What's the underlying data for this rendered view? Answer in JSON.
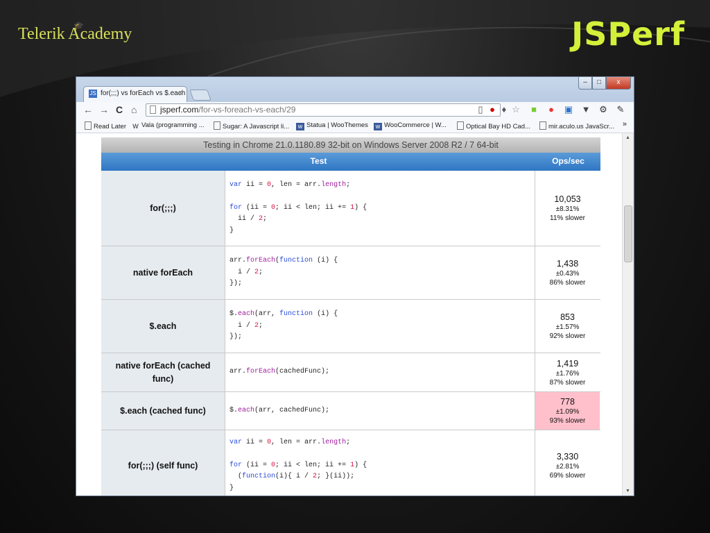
{
  "slide": {
    "logo_text": "Telerik Academy",
    "title": "JSPerf"
  },
  "browser": {
    "tab_title": "for(;;;) vs forEach vs $.each",
    "tab_close": "×",
    "window_buttons": {
      "minimize": "–",
      "maximize": "□",
      "close": "x"
    },
    "url_host": "jsperf.com",
    "url_path": "/for-vs-foreach-vs-each/29",
    "bookmarks": [
      {
        "label": "Read Later",
        "icon": "page-icon"
      },
      {
        "label": "Vala (programming ...",
        "icon": "W"
      },
      {
        "label": "Sugar: A Javascript li...",
        "icon": "page-icon"
      },
      {
        "label": "Statua | WooThemes",
        "icon": "woo-icon"
      },
      {
        "label": "WooCommerce | W...",
        "icon": "woo-icon"
      },
      {
        "label": "Optical Bay HD Cad...",
        "icon": "page-icon"
      },
      {
        "label": "mir.aculo.us JavaScr...",
        "icon": "page-icon"
      }
    ],
    "bookmarks_more": "»"
  },
  "results": {
    "caption": "Testing in Chrome 21.0.1180.89 32-bit on Windows Server 2008 R2 / 7 64-bit",
    "header_test": "Test",
    "header_ops": "Ops/sec",
    "rows": [
      {
        "name": "for(;;;)",
        "code": [
          "var ii = 0, len = arr.length;",
          "",
          "for (ii = 0; ii < len; ii += 1) {",
          "  ii / 2;",
          "}"
        ],
        "ops": "10,053",
        "error": "±8.31%",
        "slower": "11% slower",
        "slowest": false
      },
      {
        "name": "native forEach",
        "code": [
          "arr.forEach(function (i) {",
          "  i / 2;",
          "});"
        ],
        "ops": "1,438",
        "error": "±0.43%",
        "slower": "86% slower",
        "slowest": false
      },
      {
        "name": "$.each",
        "code": [
          "$.each(arr, function (i) {",
          "  i / 2;",
          "});"
        ],
        "ops": "853",
        "error": "±1.57%",
        "slower": "92% slower",
        "slowest": false
      },
      {
        "name": "native forEach (cached func)",
        "code": [
          "arr.forEach(cachedFunc);"
        ],
        "ops": "1,419",
        "error": "±1.76%",
        "slower": "87% slower",
        "slowest": false
      },
      {
        "name": "$.each (cached func)",
        "code": [
          "$.each(arr, cachedFunc);"
        ],
        "ops": "778",
        "error": "±1.09%",
        "slower": "93% slower",
        "slowest": true
      },
      {
        "name": "for(;;;) (self func)",
        "code": [
          "var ii = 0, len = arr.length;",
          "",
          "for (ii = 0; ii < len; ii += 1) {",
          "  (function(i){ i / 2; }(ii));",
          "}"
        ],
        "ops": "3,330",
        "error": "±2.81%",
        "slower": "69% slower",
        "slowest": false
      }
    ]
  },
  "colors": {
    "title": "#d4f03a",
    "logo": "#d8e05a",
    "table_header": "#2f76c3",
    "slowest_highlight": "#ffc0cb"
  }
}
